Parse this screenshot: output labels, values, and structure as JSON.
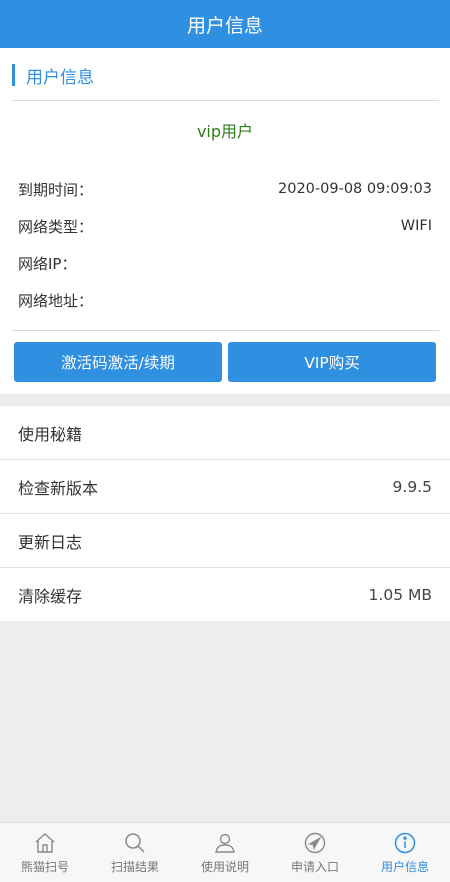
{
  "header": {
    "title": "用户信息"
  },
  "card": {
    "section_title": "用户信息",
    "vip_status": "vip用户",
    "rows": [
      {
        "label": "到期时间：",
        "value": "2020-09-08 09:09:03"
      },
      {
        "label": "网络类型：",
        "value": "WIFI"
      },
      {
        "label": "网络IP：",
        "value": ""
      },
      {
        "label": "网络地址：",
        "value": ""
      }
    ],
    "buttons": {
      "activate": "激活码激活/续期",
      "vip_buy": "VIP购买"
    }
  },
  "menu": [
    {
      "label": "使用秘籍",
      "value": ""
    },
    {
      "label": "检查新版本",
      "value": "9.9.5"
    },
    {
      "label": "更新日志",
      "value": ""
    },
    {
      "label": "清除缓存",
      "value": "1.05 MB"
    }
  ],
  "tabs": [
    {
      "label": "熊猫扫号",
      "icon": "home-icon"
    },
    {
      "label": "扫描结果",
      "icon": "search-icon"
    },
    {
      "label": "使用说明",
      "icon": "user-icon"
    },
    {
      "label": "申请入口",
      "icon": "navigation-icon"
    },
    {
      "label": "用户信息",
      "icon": "info-icon",
      "active": true
    }
  ],
  "colors": {
    "primary": "#2f8fe0",
    "vip_green": "#2e7d1d"
  }
}
